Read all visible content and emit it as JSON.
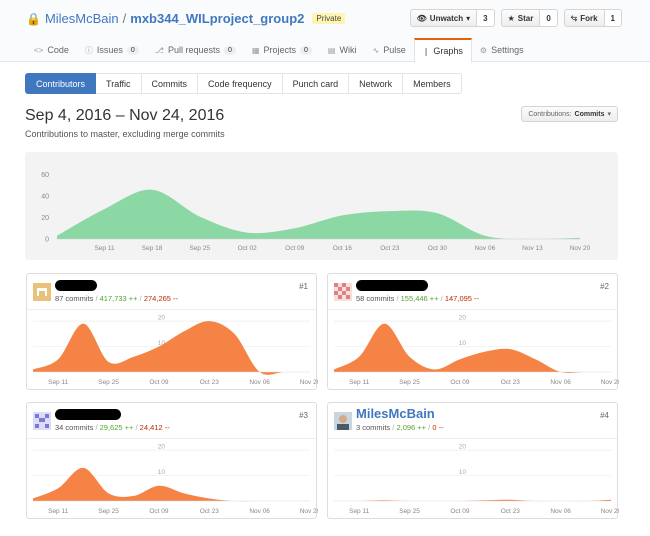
{
  "header": {
    "owner": "MilesMcBain",
    "separator": "/",
    "repo": "mxb344_WILproject_group2",
    "private_label": "Private",
    "watch": {
      "label": "Unwatch",
      "count": "3"
    },
    "star": {
      "label": "Star",
      "count": "0"
    },
    "fork": {
      "label": "Fork",
      "count": "1"
    }
  },
  "reponav": [
    {
      "label": "Code",
      "icon": "code-icon"
    },
    {
      "label": "Issues",
      "count": "0",
      "icon": "issue-icon"
    },
    {
      "label": "Pull requests",
      "count": "0",
      "icon": "pull-request-icon"
    },
    {
      "label": "Projects",
      "count": "0",
      "icon": "project-icon"
    },
    {
      "label": "Wiki",
      "icon": "book-icon"
    },
    {
      "label": "Pulse",
      "icon": "pulse-icon"
    },
    {
      "label": "Graphs",
      "icon": "graph-icon",
      "selected": true
    },
    {
      "label": "Settings",
      "icon": "gear-icon"
    }
  ],
  "subnav": [
    "Contributors",
    "Traffic",
    "Commits",
    "Code frequency",
    "Punch card",
    "Network",
    "Members"
  ],
  "range": {
    "title": "Sep 4, 2016 – Nov 24, 2016",
    "subtitle": "Contributions to master, excluding merge commits"
  },
  "contributions_select": {
    "label": "Contributions:",
    "value": "Commits"
  },
  "colors": {
    "main_area": "#8cd8a4",
    "contrib_area": "#f58345",
    "link": "#4078c0",
    "additions": "#55a532",
    "deletions": "#bd2c00"
  },
  "chart_data": [
    {
      "type": "area",
      "x": [
        "Sep 4",
        "Sep 11",
        "Sep 18",
        "Sep 25",
        "Oct 02",
        "Oct 09",
        "Oct 16",
        "Oct 23",
        "Oct 30",
        "Nov 06",
        "Nov 13",
        "Nov 20"
      ],
      "xticks": [
        "Sep 11",
        "Sep 18",
        "Sep 25",
        "Oct 02",
        "Oct 09",
        "Oct 16",
        "Oct 23",
        "Oct 30",
        "Nov 06",
        "Nov 13",
        "Nov 20"
      ],
      "values": [
        3,
        28,
        46,
        21,
        6,
        10,
        22,
        26,
        24,
        3,
        0,
        1
      ],
      "yticks": [
        "0",
        "20",
        "40",
        "60"
      ],
      "ylim": [
        0,
        70
      ]
    },
    {
      "type": "area",
      "rank": "#1",
      "commits": "87 commits",
      "additions": "417,733 ++",
      "deletions": "274,265 --",
      "xticks": [
        "Sep 11",
        "Sep 25",
        "Oct 09",
        "Oct 23",
        "Nov 06",
        "Nov 20"
      ],
      "yticks": [
        "10",
        "20"
      ],
      "values": [
        1,
        5,
        19,
        4,
        6,
        10,
        16,
        20,
        15,
        0,
        0,
        0
      ],
      "ylim": [
        0,
        22
      ]
    },
    {
      "type": "area",
      "rank": "#2",
      "commits": "58 commits",
      "additions": "155,446 ++",
      "deletions": "147,095 --",
      "xticks": [
        "Sep 11",
        "Sep 25",
        "Oct 09",
        "Oct 23",
        "Nov 06",
        "Nov 20"
      ],
      "yticks": [
        "10",
        "20"
      ],
      "values": [
        1,
        6,
        19,
        6,
        1,
        5,
        8,
        9,
        5,
        0,
        0,
        0
      ],
      "ylim": [
        0,
        22
      ]
    },
    {
      "type": "area",
      "rank": "#3",
      "commits": "34 commits",
      "additions": "29,625 ++",
      "deletions": "24,412 --",
      "xticks": [
        "Sep 11",
        "Sep 25",
        "Oct 09",
        "Oct 23",
        "Nov 06",
        "Nov 20"
      ],
      "yticks": [
        "10",
        "20"
      ],
      "values": [
        1,
        5,
        13,
        3,
        2,
        6,
        3,
        1,
        0,
        0,
        0,
        0
      ],
      "ylim": [
        0,
        22
      ]
    },
    {
      "type": "area",
      "rank": "#4",
      "login": "MilesMcBain",
      "commits": "3 commits",
      "additions": "2,096 ++",
      "deletions": "0 --",
      "xticks": [
        "Sep 11",
        "Sep 25",
        "Oct 09",
        "Oct 23",
        "Nov 06",
        "Nov 20"
      ],
      "yticks": [
        "10",
        "20"
      ],
      "values": [
        0,
        0,
        0.3,
        0,
        0,
        0,
        0.3,
        0.5,
        0,
        0,
        0,
        0.5
      ],
      "ylim": [
        0,
        22
      ]
    }
  ]
}
